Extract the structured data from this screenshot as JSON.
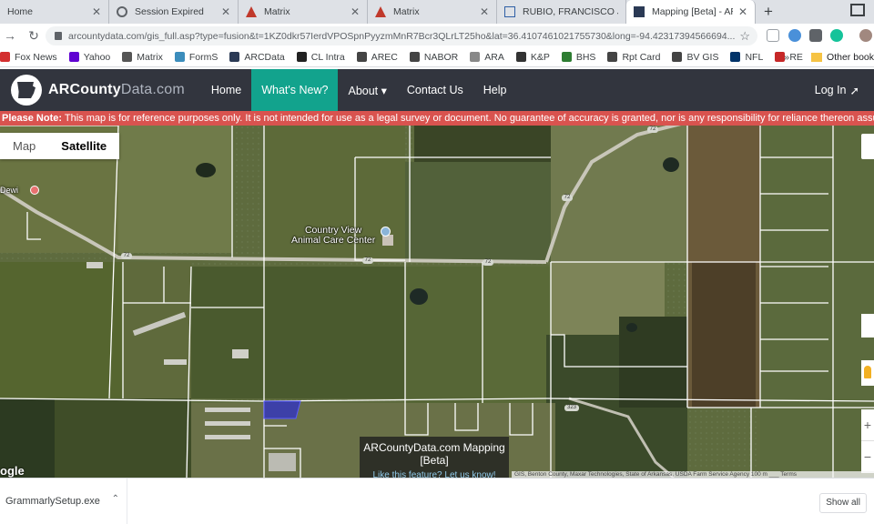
{
  "browser": {
    "tabs": [
      {
        "title": "Home",
        "favicon_color": "#1a73e8",
        "active": false
      },
      {
        "title": "Session Expired",
        "favicon_color": "#5f6368",
        "active": false
      },
      {
        "title": "Matrix",
        "favicon_color": "#c0392b",
        "active": false
      },
      {
        "title": "Matrix",
        "favicon_color": "#c0392b",
        "active": false
      },
      {
        "title": "RUBIO, FRANCISCO JAV",
        "favicon_color": "#2f5fa5",
        "active": false
      },
      {
        "title": "Mapping [Beta] - ARCo",
        "favicon_color": "#2b3a55",
        "active": true
      }
    ],
    "new_tab": "+",
    "url": "arcountydata.com/gis_full.asp?type=fusion&t=1KZ0dkr57IerdVPOSpnPyyzmMnR7Bcr3QLrLT25ho&lat=36.4107461021755730&long=-94.42317394566694...",
    "bookmarks": [
      {
        "label": "Fox News",
        "color": "#d32f2f"
      },
      {
        "label": "Yahoo",
        "color": "#6001d2"
      },
      {
        "label": "Matrix",
        "color": "#555555"
      },
      {
        "label": "FormS",
        "color": "#3c8dbc"
      },
      {
        "label": "ARCData",
        "color": "#2b3a55"
      },
      {
        "label": "CL Intra",
        "color": "#222222"
      },
      {
        "label": "AREC",
        "color": "#444444"
      },
      {
        "label": "NABOR",
        "color": "#444444"
      },
      {
        "label": "ARA",
        "color": "#888888"
      },
      {
        "label": "K&P",
        "color": "#333333"
      },
      {
        "label": "BHS",
        "color": "#2e7d32"
      },
      {
        "label": "Rpt Card",
        "color": "#444444"
      },
      {
        "label": "BV GIS",
        "color": "#444444"
      },
      {
        "label": "NFL",
        "color": "#013369"
      },
      {
        "label": "RE Wash Cty",
        "color": "#c62828"
      }
    ],
    "bookmarks_more": "»",
    "other_bookmarks": "Other book"
  },
  "site": {
    "logo_brand": "ARCounty",
    "logo_suffix": "Data.com",
    "nav": [
      {
        "label": "Home",
        "active": false
      },
      {
        "label": "What's New?",
        "active": true
      },
      {
        "label": "About ▾",
        "active": false
      },
      {
        "label": "Contact Us",
        "active": false
      },
      {
        "label": "Help",
        "active": false
      }
    ],
    "login": "Log In",
    "notice_prefix": "Please Note:",
    "notice_text": " This map is for reference purposes only. It is not intended for use as a legal survey or document. No guarantee of accuracy is granted, nor is any responsibility for reliance thereon assume"
  },
  "map": {
    "type_options": [
      "Map",
      "Satellite"
    ],
    "selected_type": "Satellite",
    "poi_name_line1": "Country View",
    "poi_name_line2": "Animal Care Center",
    "red_poi_label": "Dewi",
    "road_shields": [
      "72",
      "72",
      "72",
      "72",
      "72",
      "323"
    ],
    "overlay_title": "ARCountyData.com Mapping",
    "overlay_subtitle": "[Beta]",
    "overlay_link": "Like this feature? Let us know!",
    "attribution": "GIS, Benton County, Maxar Technologies, State of Arkansas, USDA Farm Service Agency  100 m ___  Terms",
    "google": "ogle",
    "colors": {
      "parcel_line": "#ffffff",
      "highlight": "#2f30c8",
      "header": "#32353e",
      "accent": "#12a38d",
      "notice": "#d9534f"
    }
  },
  "downloads": {
    "file": "GrammarlySetup.exe",
    "show_all": "Show all"
  }
}
